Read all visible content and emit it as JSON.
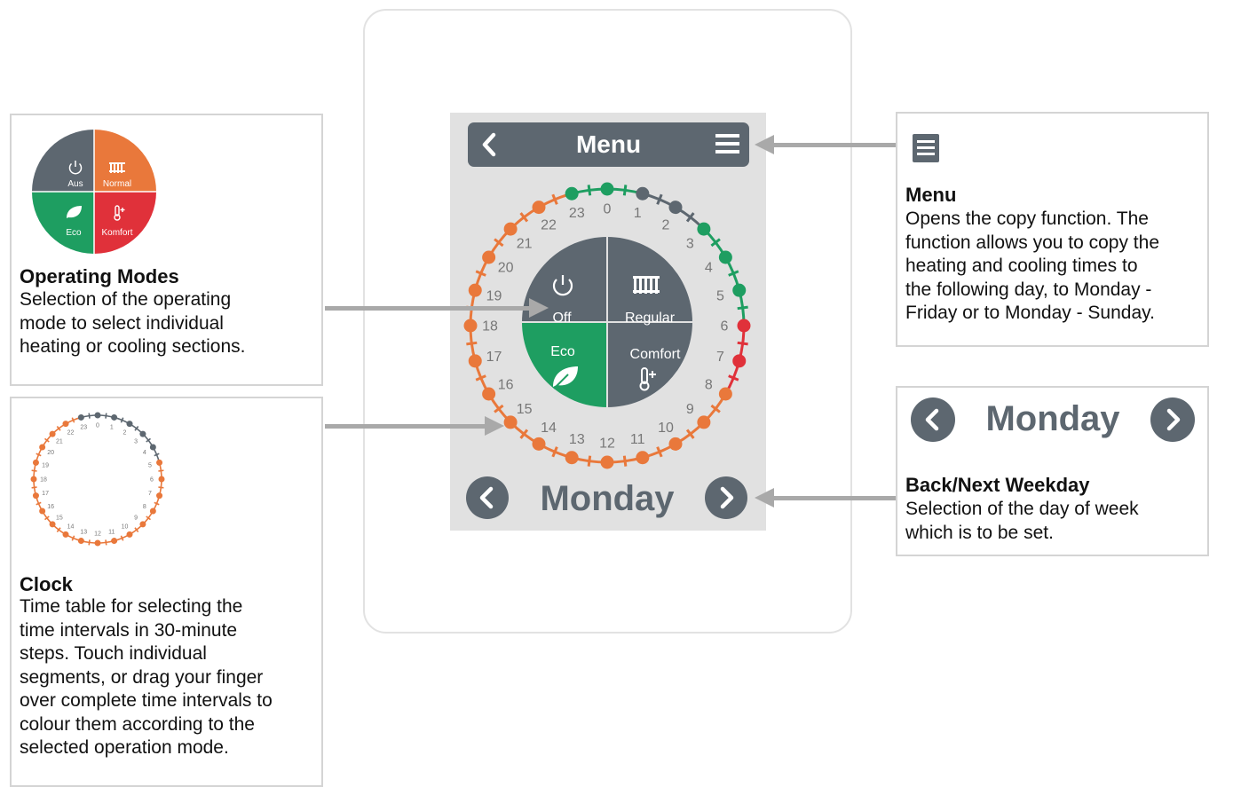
{
  "device": {
    "menu_bar": {
      "title": "Menu",
      "back_icon": "chevron-left-icon",
      "menu_icon": "hamburger-icon"
    },
    "modes": [
      {
        "label": "Off",
        "icon": "power-icon",
        "color": "#5d6770"
      },
      {
        "label": "Regular",
        "icon": "radiator-icon",
        "color": "#5d6770"
      },
      {
        "label": "Eco",
        "icon": "leaf-icon",
        "color": "#1e9e61"
      },
      {
        "label": "Comfort",
        "icon": "thermometer-plus-icon",
        "color": "#5d6770"
      }
    ],
    "clock_hours": [
      "0",
      "1",
      "2",
      "3",
      "4",
      "5",
      "6",
      "7",
      "8",
      "9",
      "10",
      "11",
      "12",
      "13",
      "14",
      "15",
      "16",
      "17",
      "18",
      "19",
      "20",
      "21",
      "22",
      "23"
    ],
    "day": "Monday",
    "colors": {
      "dark": "#5d6770",
      "green": "#1e9e61",
      "orange": "#e9783b",
      "red": "#e0313a",
      "screen": "#e1e1e1"
    }
  },
  "operating_modes": {
    "title": "Operating Modes",
    "text": [
      "Selection of the operating",
      "mode to select individual",
      "heating or cooling sections."
    ],
    "icon_modes": [
      "Aus",
      "Normal",
      "Eco",
      "Komfort"
    ]
  },
  "clock": {
    "title": "Clock",
    "text": [
      "Time table for selecting the",
      "time intervals in 30-minute",
      "steps. Touch individual",
      "segments, or drag your finger",
      "over complete time intervals to",
      "colour them according to the",
      "selected operation mode."
    ],
    "mini_hours": [
      "0",
      "1",
      "2",
      "3",
      "4",
      "5",
      "6",
      "7",
      "8",
      "9",
      "10",
      "11",
      "12",
      "13",
      "14",
      "15",
      "16",
      "17",
      "18",
      "19",
      "20",
      "21",
      "22",
      "23"
    ]
  },
  "menu": {
    "title": "Menu",
    "icon": "menu-list-icon",
    "text": [
      "Opens the copy function. The",
      "function allows you to copy the",
      "heating and cooling times to",
      "the following day, to Monday -",
      "Friday or to Monday - Sunday."
    ]
  },
  "weekday": {
    "day": "Monday",
    "title": "Back/Next Weekday",
    "text": [
      "Selection of the day of week",
      "which is to be set."
    ]
  }
}
